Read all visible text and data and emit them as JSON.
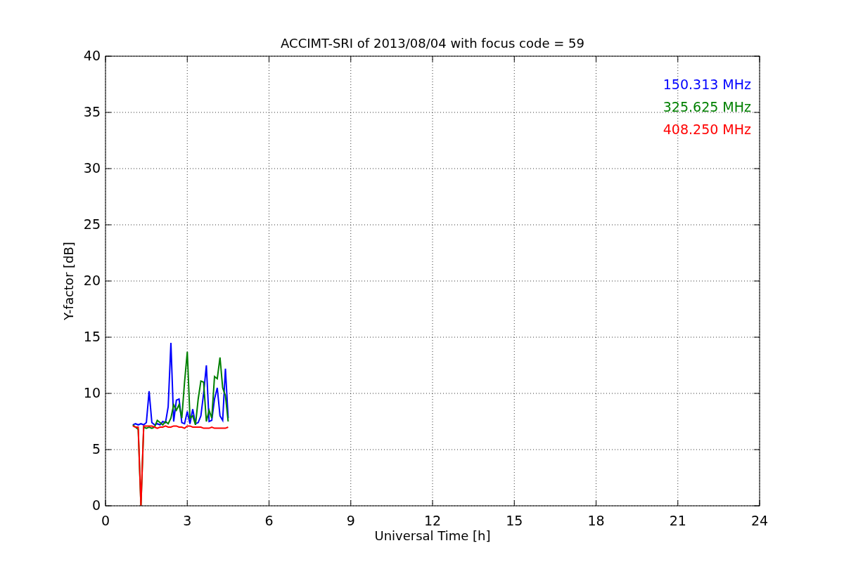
{
  "chart_data": {
    "type": "line",
    "title": "ACCIMT-SRI of 2013/08/04 with focus code = 59",
    "xlabel": "Universal Time [h]",
    "ylabel": "Y-factor [dB]",
    "x": [
      1.0,
      1.1,
      1.2,
      1.3,
      1.4,
      1.5,
      1.6,
      1.7,
      1.8,
      1.9,
      2.0,
      2.1,
      2.2,
      2.3,
      2.4,
      2.5,
      2.6,
      2.7,
      2.8,
      2.9,
      3.0,
      3.1,
      3.2,
      3.3,
      3.4,
      3.5,
      3.6,
      3.7,
      3.8,
      3.9,
      4.0,
      4.1,
      4.2,
      4.3,
      4.4,
      4.5
    ],
    "series": [
      {
        "name": "150.313 MHz",
        "color": "#0000ff",
        "values": [
          7.2,
          7.3,
          7.2,
          7.3,
          7.2,
          7.4,
          10.2,
          7.4,
          7.2,
          7.3,
          7.2,
          7.5,
          7.4,
          8.8,
          14.5,
          7.5,
          9.4,
          9.5,
          7.4,
          7.3,
          8.4,
          7.3,
          8.6,
          7.3,
          7.4,
          8.0,
          10.0,
          12.5,
          7.5,
          7.6,
          9.5,
          10.5,
          8.0,
          7.6,
          12.2,
          7.8
        ]
      },
      {
        "name": "325.625 MHz",
        "color": "#008000",
        "values": [
          7.2,
          7.0,
          6.8,
          0,
          7.0,
          6.9,
          7.0,
          6.9,
          7.0,
          7.6,
          7.4,
          7.2,
          7.5,
          7.3,
          7.8,
          9.0,
          8.5,
          9.0,
          7.8,
          11.0,
          13.7,
          7.8,
          8.0,
          7.2,
          9.5,
          11.1,
          11.0,
          7.5,
          8.5,
          7.8,
          11.5,
          11.3,
          13.2,
          10.5,
          9.8,
          7.5
        ]
      },
      {
        "name": "408.250 MHz",
        "color": "#ff0000",
        "values": [
          7.1,
          7.0,
          7.0,
          0,
          7.1,
          7.1,
          7.1,
          7.1,
          7.0,
          6.9,
          7.0,
          7.0,
          7.1,
          7.0,
          7.0,
          7.1,
          7.1,
          7.0,
          7.0,
          6.9,
          7.1,
          7.1,
          7.0,
          7.0,
          7.0,
          7.0,
          6.9,
          6.9,
          6.9,
          7.0,
          6.9,
          6.9,
          6.9,
          6.9,
          6.9,
          7.0
        ]
      }
    ],
    "grid": true,
    "xlim": [
      0,
      24
    ],
    "ylim": [
      0,
      40
    ],
    "xticks": [
      0,
      3,
      6,
      9,
      12,
      15,
      18,
      21,
      24
    ],
    "yticks": [
      0,
      5,
      10,
      15,
      20,
      25,
      30,
      35,
      40
    ]
  }
}
